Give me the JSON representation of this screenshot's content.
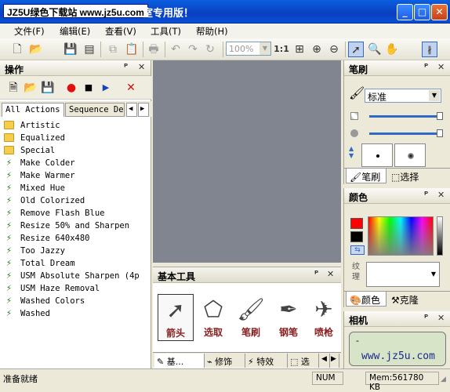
{
  "titlebar": {
    "watermark": "JZ5U绿色下载站 www.jz5u.com",
    "title": "室专用版！",
    "minimize": "_",
    "maximize": "□",
    "close": "✕"
  },
  "menu": [
    {
      "label": "文件(F)"
    },
    {
      "label": "编辑(E)"
    },
    {
      "label": "查看(V)"
    },
    {
      "label": "工具(T)"
    },
    {
      "label": "帮助(H)"
    }
  ],
  "toolbar": {
    "zoom": "100%",
    "ratio": "1:1"
  },
  "actions_panel": {
    "title": "操作",
    "tabs": [
      "All Actions",
      "Sequence Det"
    ],
    "items": [
      {
        "label": "Artistic",
        "type": "folder"
      },
      {
        "label": "Equalized",
        "type": "folder"
      },
      {
        "label": "Special",
        "type": "folder"
      },
      {
        "label": "Make Colder",
        "type": "action"
      },
      {
        "label": "Make Warmer",
        "type": "action"
      },
      {
        "label": "Mixed Hue",
        "type": "action"
      },
      {
        "label": "Old Colorized",
        "type": "action"
      },
      {
        "label": "Remove Flash Blue",
        "type": "action"
      },
      {
        "label": "Resize 50% and Sharpen",
        "type": "action"
      },
      {
        "label": "Resize 640x480",
        "type": "action"
      },
      {
        "label": "Too Jazzy",
        "type": "action"
      },
      {
        "label": "Total Dream",
        "type": "action"
      },
      {
        "label": "USM Absolute Sharpen (4p",
        "type": "action"
      },
      {
        "label": "USM Haze Removal",
        "type": "action"
      },
      {
        "label": "Washed Colors",
        "type": "action"
      },
      {
        "label": "Washed",
        "type": "action"
      }
    ]
  },
  "basic_tools": {
    "title": "基本工具",
    "tools": [
      {
        "label": "箭头",
        "icon": "arrow-icon"
      },
      {
        "label": "选取",
        "icon": "lasso-icon"
      },
      {
        "label": "笔刷",
        "icon": "brush-icon"
      },
      {
        "label": "钢笔",
        "icon": "pen-icon"
      },
      {
        "label": "喷枪",
        "icon": "airbrush-icon"
      }
    ],
    "tabs": [
      "基...",
      "修饰",
      "特效",
      "选"
    ]
  },
  "brush_panel": {
    "title": "笔刷",
    "preset": "标准",
    "tabs": [
      "笔刷",
      "选择"
    ]
  },
  "color_panel": {
    "title": "颜色",
    "texture_label": "纹理",
    "tabs": [
      "颜色",
      "克隆"
    ],
    "foreground": "#ff0000",
    "background": "#000000"
  },
  "camera_panel": {
    "title": "相机",
    "placeholder": "-"
  },
  "watermark_url": "www.jz5u.com",
  "status": {
    "text": "准备就绪",
    "num": "NUM",
    "mem": "Mem:561780 KB"
  }
}
